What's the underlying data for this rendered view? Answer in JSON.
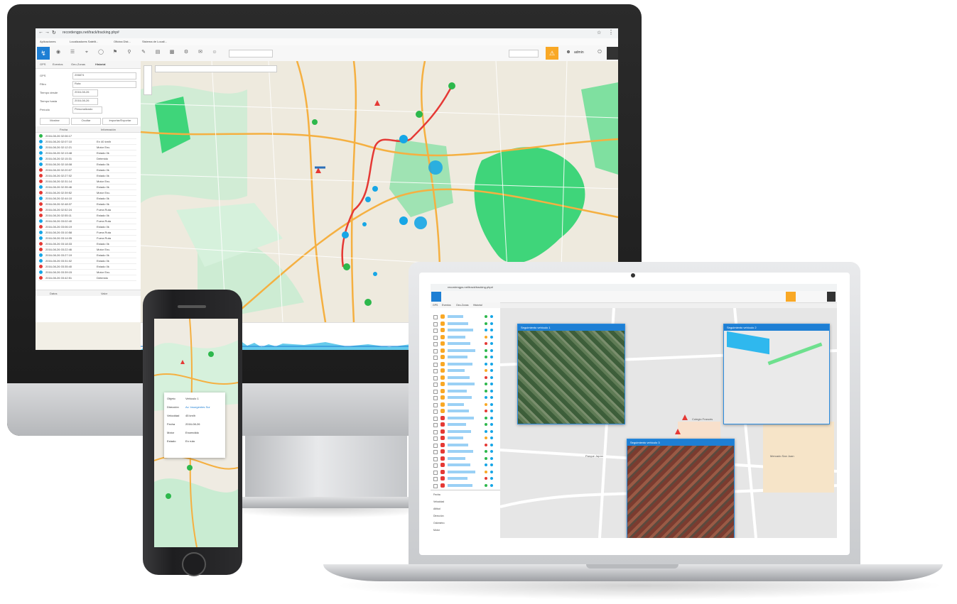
{
  "desktop": {
    "url": "recordengps.net/track/tracking.php#",
    "bookmarks": [
      "Aplicaciones",
      "Localizadores Satelit...",
      "Oficina Dist...",
      "Sistema de Locali..."
    ],
    "search_user": "admin",
    "tabs": [
      "GPS",
      "Eventos",
      "Geo-Zonas",
      "Historial"
    ],
    "form_labels": [
      "GPS",
      "Filtro",
      "Tiempo desde",
      "Tiempo hasta",
      "Período"
    ],
    "form_values": [
      "206874",
      "Ruta",
      "2016-08-26",
      "2016-08-26",
      "Personalizado"
    ],
    "buttons": [
      "Mostrar",
      "Ocultar",
      "Importar/Exportar"
    ],
    "table_headers": [
      "Fecha",
      "Información"
    ],
    "rows": [
      {
        "date": "2016-08-26 02:06:17",
        "info": "",
        "color": "#2db84c"
      },
      {
        "date": "2016-08-26 02:07:10",
        "info": "En 40 km/h",
        "color": "#16a6e6"
      },
      {
        "date": "2016-08-26 02:12:21",
        "info": "Motor Enc.",
        "color": "#16a6e6"
      },
      {
        "date": "2016-08-26 02:13:48",
        "info": "Estado 0k",
        "color": "#16a6e6"
      },
      {
        "date": "2016-08-26 02:15:31",
        "info": "Detenido",
        "color": "#16a6e6"
      },
      {
        "date": "2016-08-26 02:18:08",
        "info": "Estado 0k",
        "color": "#16a6e6"
      },
      {
        "date": "2016-08-26 02:20:07",
        "info": "Estado 0k",
        "color": "#e53935"
      },
      {
        "date": "2016-08-26 02:27:02",
        "info": "Estado 0k",
        "color": "#e53935"
      },
      {
        "date": "2016-08-26 02:31:14",
        "info": "Motor Enc.",
        "color": "#e53935"
      },
      {
        "date": "2016-08-26 02:35:46",
        "info": "Estado 0k",
        "color": "#16a6e6"
      },
      {
        "date": "2016-08-26 02:39:52",
        "info": "Motor Enc.",
        "color": "#e53935"
      },
      {
        "date": "2016-08-26 02:44:10",
        "info": "Estado 0k",
        "color": "#16a6e6"
      },
      {
        "date": "2016-08-26 02:48:37",
        "info": "Estado 0k",
        "color": "#e53935"
      },
      {
        "date": "2016-08-26 02:52:24",
        "info": "Fuera Ruta",
        "color": "#e53935"
      },
      {
        "date": "2016-08-26 02:55:11",
        "info": "Estado 0k",
        "color": "#e53935"
      },
      {
        "date": "2016-08-26 03:02:40",
        "info": "Fuera Ruta",
        "color": "#16a6e6"
      },
      {
        "date": "2016-08-26 03:06:19",
        "info": "Estado 0k",
        "color": "#e53935"
      },
      {
        "date": "2016-08-26 03:10:58",
        "info": "Fuera Ruta",
        "color": "#16a6e6"
      },
      {
        "date": "2016-08-26 03:14:05",
        "info": "Fuera Ruta",
        "color": "#16a6e6"
      },
      {
        "date": "2016-08-26 03:18:33",
        "info": "Estado 0k",
        "color": "#e53935"
      },
      {
        "date": "2016-08-26 03:22:46",
        "info": "Motor Enc.",
        "color": "#e53935"
      },
      {
        "date": "2016-08-26 03:27:19",
        "info": "Estado 0k",
        "color": "#16a6e6"
      },
      {
        "date": "2016-08-26 03:31:02",
        "info": "Estado 0k",
        "color": "#16a6e6"
      },
      {
        "date": "2016-08-26 03:35:40",
        "info": "Estado 0k",
        "color": "#e53935"
      },
      {
        "date": "2016-08-26 03:39:15",
        "info": "Motor Enc.",
        "color": "#16a6e6"
      },
      {
        "date": "2016-08-26 03:42:51",
        "info": "Detenido",
        "color": "#e53935"
      }
    ],
    "bottom_tabs": [
      "Datos",
      "Valor"
    ]
  },
  "laptop": {
    "url": "recordengps.net/track/tracking.php#",
    "tabs": [
      "GPS",
      "Eventos",
      "Geo-Zonas",
      "Historial"
    ],
    "popups": [
      "Seguimiento vehículo 1",
      "Seguimiento vehículo 2",
      "Seguimiento vehículo 3"
    ],
    "map_labels": [
      "Colegio Francés",
      "Parque Japón",
      "Mercado San Juan"
    ],
    "info_labels": [
      "Fecha",
      "Velocidad",
      "Altitud",
      "Dirección",
      "Odómetro",
      "Motor"
    ]
  },
  "phone": {
    "popup_labels": [
      "Objeto",
      "Dirección",
      "Velocidad",
      "Fecha",
      "Motor",
      "Estado"
    ],
    "popup_values": [
      "Vehículo 1",
      "Av. Insurgentes Sur",
      "45 km/h",
      "2016-08-26",
      "Encendido",
      "En ruta"
    ]
  },
  "colors": {
    "accent": "#1e7fd4",
    "park": "#3fd57a",
    "road_orange": "#f5b041",
    "route_red": "#e53935",
    "marker_green": "#2db84c",
    "marker_blue": "#16a6e6",
    "toolbar_orange": "#f9a825"
  }
}
